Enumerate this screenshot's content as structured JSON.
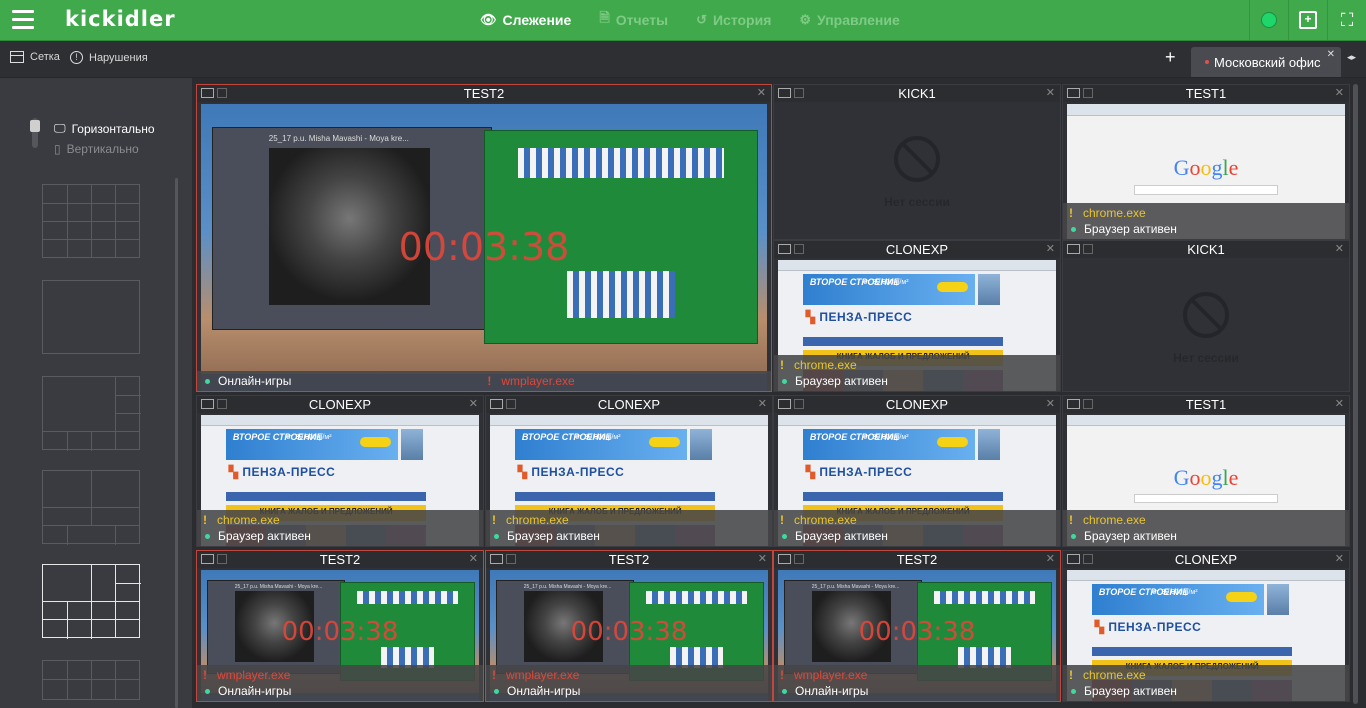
{
  "app": {
    "logo": "kickidler",
    "nav": [
      {
        "label": "Слежение",
        "icon": "eye-icon",
        "glyph": "👁",
        "active": true
      },
      {
        "label": "Отчеты",
        "icon": "document-icon",
        "glyph": "🗎",
        "active": false
      },
      {
        "label": "История",
        "icon": "history-icon",
        "glyph": "↺",
        "active": false
      },
      {
        "label": "Управление",
        "icon": "gear-icon",
        "glyph": "⚙",
        "active": false
      }
    ]
  },
  "toolbar": {
    "grid_label": "Сетка",
    "violations_label": "Нарушения",
    "add_label": "+",
    "office_tab": "Московский офис"
  },
  "sidebar": {
    "horizontal": "Горизонтально",
    "vertical": "Вертикально"
  },
  "tiles": [
    {
      "title": "TEST2",
      "screen": "game",
      "alert": true,
      "timer": "00:03:38",
      "rows": [
        {
          "kind": "online",
          "text": "Онлайн-игры"
        },
        {
          "kind": "red",
          "text": "wmplayer.exe"
        }
      ]
    },
    {
      "title": "KICK1",
      "screen": "none",
      "alert": false,
      "nosession": "Нет сессии",
      "rows": []
    },
    {
      "title": "TEST1",
      "screen": "google",
      "alert": false,
      "rows": [
        {
          "kind": "warn",
          "text": "chrome.exe"
        },
        {
          "kind": "online",
          "text": "Браузер активен"
        }
      ]
    },
    {
      "title": "CLONEXP",
      "screen": "news",
      "alert": false,
      "rows": [
        {
          "kind": "warn",
          "text": "chrome.exe"
        },
        {
          "kind": "online",
          "text": "Браузер активен"
        }
      ]
    },
    {
      "title": "KICK1",
      "screen": "none",
      "alert": false,
      "nosession": "Нет сессии",
      "rows": []
    },
    {
      "title": "CLONEXP",
      "screen": "news",
      "alert": false,
      "rows": [
        {
          "kind": "warn",
          "text": "chrome.exe"
        },
        {
          "kind": "online",
          "text": "Браузер активен"
        }
      ]
    },
    {
      "title": "CLONEXP",
      "screen": "news",
      "alert": false,
      "rows": [
        {
          "kind": "warn",
          "text": "chrome.exe"
        },
        {
          "kind": "online",
          "text": "Браузер активен"
        }
      ]
    },
    {
      "title": "CLONEXP",
      "screen": "news",
      "alert": false,
      "rows": [
        {
          "kind": "warn",
          "text": "chrome.exe"
        },
        {
          "kind": "online",
          "text": "Браузер активен"
        }
      ]
    },
    {
      "title": "TEST1",
      "screen": "google",
      "alert": false,
      "rows": [
        {
          "kind": "warn",
          "text": "chrome.exe"
        },
        {
          "kind": "online",
          "text": "Браузер активен"
        }
      ]
    },
    {
      "title": "TEST2",
      "screen": "game",
      "alert": true,
      "timer": "00:03:38",
      "rows": [
        {
          "kind": "red",
          "text": "wmplayer.exe"
        },
        {
          "kind": "online",
          "text": "Онлайн-игры"
        }
      ]
    },
    {
      "title": "TEST2",
      "screen": "game",
      "alert": true,
      "timer": "00:03:38",
      "rows": [
        {
          "kind": "red",
          "text": "wmplayer.exe"
        },
        {
          "kind": "online",
          "text": "Онлайн-игры"
        }
      ]
    },
    {
      "title": "TEST2",
      "screen": "game",
      "alert": true,
      "timer": "00:03:38",
      "rows": [
        {
          "kind": "red",
          "text": "wmplayer.exe"
        },
        {
          "kind": "online",
          "text": "Онлайн-игры"
        }
      ]
    },
    {
      "title": "CLONEXP",
      "screen": "news",
      "alert": false,
      "rows": [
        {
          "kind": "warn",
          "text": "chrome.exe"
        },
        {
          "kind": "online",
          "text": "Браузер активен"
        }
      ]
    }
  ],
  "screen_text": {
    "wmp_title": "25_17 p.u. Misha Mavashi - Moya kre...",
    "news_brand": "ПЕНЗА-ПРЕСС",
    "news_banner": "ВТОРОЕ СТРОЕНИЕ",
    "news_price": "от 39 000 р/м²",
    "news_book": "КНИГА ЖАЛОБ И ПРЕДЛОЖЕНИЙ",
    "google": "Google"
  },
  "colors": {
    "brand_green": "#3fa94b",
    "alert_red": "#e0473a",
    "warn_yellow": "#e8c531",
    "online_teal": "#3fd9a0"
  }
}
